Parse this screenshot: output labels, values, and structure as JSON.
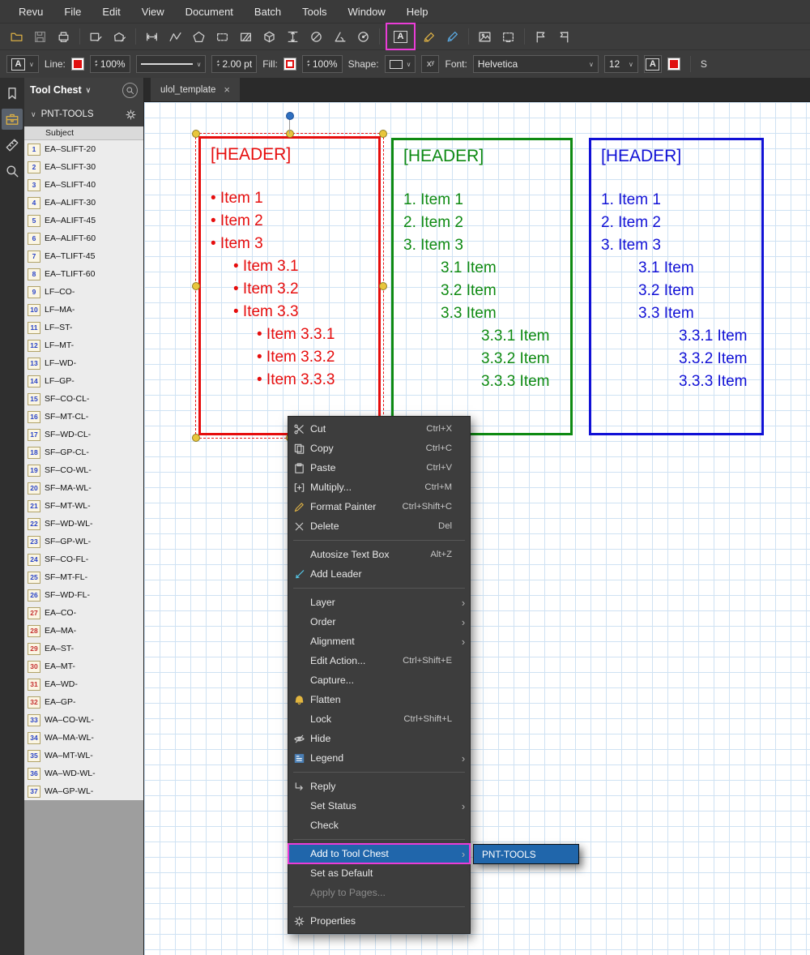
{
  "menubar": {
    "items": [
      "Revu",
      "File",
      "Edit",
      "View",
      "Document",
      "Batch",
      "Tools",
      "Window",
      "Help"
    ]
  },
  "toolbar_main": {
    "highlight_color": "#ea3cd7",
    "highlighted_icon": "text-box-icon",
    "groups": [
      {
        "icons": [
          "open-folder-icon",
          "save-icon",
          "print-icon"
        ]
      },
      {
        "icons": [
          "sketch-rectangle-icon",
          "sketch-polygon-icon"
        ]
      },
      {
        "icons": [
          "measure-length-icon",
          "measure-polyline-icon",
          "measure-polygon-icon",
          "measure-rectangle-icon",
          "measure-area-icon",
          "measure-volume-icon",
          "measure-height-icon",
          "measure-diameter-icon",
          "measure-angle-icon",
          "measure-radius-icon"
        ]
      },
      {
        "icons": [
          "text-box-icon",
          "highlighter-icon",
          "pen-icon"
        ]
      },
      {
        "icons": [
          "image-icon",
          "snapshot-icon"
        ]
      },
      {
        "icons": [
          "place-flag-icon",
          "remove-flag-icon"
        ]
      }
    ]
  },
  "toolbar_props": {
    "text_style_glyph": "A",
    "line": {
      "label": "Line:",
      "color": "#e01010",
      "opacity": "100%",
      "width": "2.00 pt"
    },
    "fill": {
      "label": "Fill:",
      "opacity": "100%"
    },
    "shape_label": "Shape:",
    "superscript_glyph": "xʸ",
    "font": {
      "label": "Font:",
      "family": "Helvetica",
      "size": "12"
    },
    "autosize_glyph": "A",
    "trailing_label": "S"
  },
  "tabbar": {
    "tabs": [
      {
        "label": "ulol_template",
        "active": true
      }
    ]
  },
  "left_strip": {
    "icons": [
      {
        "name": "bookmarks-icon",
        "active": false
      },
      {
        "name": "tool-chest-icon",
        "active": true
      },
      {
        "name": "measurements-icon",
        "active": false
      },
      {
        "name": "search-icon",
        "active": false
      }
    ]
  },
  "tool_chest": {
    "title": "Tool Chest",
    "group_label": "PNT-TOOLS",
    "column_header": "Subject",
    "items": [
      {
        "n": 1,
        "label": "EA–SLIFT-20"
      },
      {
        "n": 2,
        "label": "EA–SLIFT-30"
      },
      {
        "n": 3,
        "label": "EA–SLIFT-40"
      },
      {
        "n": 4,
        "label": "EA–ALIFT-30"
      },
      {
        "n": 5,
        "label": "EA–ALIFT-45"
      },
      {
        "n": 6,
        "label": "EA–ALIFT-60"
      },
      {
        "n": 7,
        "label": "EA–TLIFT-45"
      },
      {
        "n": 8,
        "label": "EA–TLIFT-60"
      },
      {
        "n": 9,
        "label": "LF–CO-"
      },
      {
        "n": 10,
        "label": "LF–MA-"
      },
      {
        "n": 11,
        "label": "LF–ST-"
      },
      {
        "n": 12,
        "label": "LF–MT-"
      },
      {
        "n": 13,
        "label": "LF–WD-"
      },
      {
        "n": 14,
        "label": "LF–GP-"
      },
      {
        "n": 15,
        "label": "SF–CO-CL-"
      },
      {
        "n": 16,
        "label": "SF–MT-CL-"
      },
      {
        "n": 17,
        "label": "SF–WD-CL-"
      },
      {
        "n": 18,
        "label": "SF–GP-CL-"
      },
      {
        "n": 19,
        "label": "SF–CO-WL-"
      },
      {
        "n": 20,
        "label": "SF–MA-WL-"
      },
      {
        "n": 21,
        "label": "SF–MT-WL-"
      },
      {
        "n": 22,
        "label": "SF–WD-WL-"
      },
      {
        "n": 23,
        "label": "SF–GP-WL-"
      },
      {
        "n": 24,
        "label": "SF–CO-FL-"
      },
      {
        "n": 25,
        "label": "SF–MT-FL-"
      },
      {
        "n": 26,
        "label": "SF–WD-FL-"
      },
      {
        "n": 27,
        "label": "EA–CO-",
        "red": true
      },
      {
        "n": 28,
        "label": "EA–MA-",
        "red": true
      },
      {
        "n": 29,
        "label": "EA–ST-",
        "red": true
      },
      {
        "n": 30,
        "label": "EA–MT-",
        "red": true
      },
      {
        "n": 31,
        "label": "EA–WD-",
        "red": true
      },
      {
        "n": 32,
        "label": "EA–GP-",
        "red": true
      },
      {
        "n": 33,
        "label": "WA–CO-WL-"
      },
      {
        "n": 34,
        "label": "WA–MA-WL-"
      },
      {
        "n": 35,
        "label": "WA–MT-WL-"
      },
      {
        "n": 36,
        "label": "WA–WD-WL-"
      },
      {
        "n": 37,
        "label": "WA–GP-WL-"
      }
    ]
  },
  "canvas": {
    "selection": {
      "outline_color": "#e81414",
      "handle_color": "#e8c63c",
      "rotation_handle_color": "#2e6fc0"
    },
    "text_boxes": [
      {
        "name": "bullet-list-text-box",
        "color": "#e60d0d",
        "list_style": "bullet",
        "header": "[HEADER]",
        "lines": [
          {
            "text": "• Item 1",
            "lvl": 0
          },
          {
            "text": "• Item 2",
            "lvl": 0
          },
          {
            "text": "• Item 3",
            "lvl": 0
          },
          {
            "text": "• Item 3.1",
            "lvl": 1
          },
          {
            "text": "• Item 3.2",
            "lvl": 1
          },
          {
            "text": "• Item 3.3",
            "lvl": 1
          },
          {
            "text": "• Item 3.3.1",
            "lvl": 2
          },
          {
            "text": "• Item 3.3.2",
            "lvl": 2
          },
          {
            "text": "• Item 3.3.3",
            "lvl": 2
          }
        ]
      },
      {
        "name": "numbered-list-text-box-green",
        "color": "#0e8a12",
        "list_style": "numbered",
        "header": "[HEADER]",
        "lines": [
          {
            "text": "1. Item 1",
            "lvl": 0
          },
          {
            "text": "2. Item 2",
            "lvl": 0
          },
          {
            "text": "3. Item 3",
            "lvl": 0
          },
          {
            "text": "3.1 Item",
            "lvl": 1
          },
          {
            "text": "3.2 Item",
            "lvl": 1
          },
          {
            "text": "3.3 Item",
            "lvl": 1
          },
          {
            "text": "3.3.1 Item",
            "lvl": 2
          },
          {
            "text": "3.3.2 Item",
            "lvl": 2
          },
          {
            "text": "3.3.3 Item",
            "lvl": 2
          }
        ]
      },
      {
        "name": "numbered-list-text-box-blue",
        "color": "#1111d6",
        "list_style": "numbered",
        "header": "[HEADER]",
        "lines": [
          {
            "text": "1. Item 1",
            "lvl": 0
          },
          {
            "text": "2. Item 2",
            "lvl": 0
          },
          {
            "text": "3. Item 3",
            "lvl": 0
          },
          {
            "text": "3.1 Item",
            "lvl": 1
          },
          {
            "text": "3.2 Item",
            "lvl": 1
          },
          {
            "text": "3.3 Item",
            "lvl": 1
          },
          {
            "text": "3.3.1 Item",
            "lvl": 2
          },
          {
            "text": "3.3.2 Item",
            "lvl": 2
          },
          {
            "text": "3.3.3 Item",
            "lvl": 2
          }
        ]
      }
    ]
  },
  "context_menu": {
    "highlight_bg": "#2066ab",
    "highlight_border": "#ea3cd7",
    "items": [
      {
        "label": "Cut",
        "shortcut": "Ctrl+X",
        "icon": "cut-icon"
      },
      {
        "label": "Copy",
        "shortcut": "Ctrl+C",
        "icon": "copy-icon"
      },
      {
        "label": "Paste",
        "shortcut": "Ctrl+V",
        "icon": "paste-icon"
      },
      {
        "label": "Multiply...",
        "shortcut": "Ctrl+M",
        "icon": "multiply-icon"
      },
      {
        "label": "Format Painter",
        "shortcut": "Ctrl+Shift+C",
        "icon": "format-painter-icon"
      },
      {
        "label": "Delete",
        "shortcut": "Del",
        "icon": "delete-icon"
      },
      {
        "sep": true
      },
      {
        "label": "Autosize Text Box",
        "shortcut": "Alt+Z"
      },
      {
        "label": "Add Leader",
        "icon": "add-leader-icon"
      },
      {
        "sep": true
      },
      {
        "label": "Layer",
        "submenu": true
      },
      {
        "label": "Order",
        "submenu": true
      },
      {
        "label": "Alignment",
        "submenu": true
      },
      {
        "label": "Edit Action...",
        "shortcut": "Ctrl+Shift+E"
      },
      {
        "label": "Capture..."
      },
      {
        "label": "Flatten",
        "icon": "flatten-icon"
      },
      {
        "label": "Lock",
        "shortcut": "Ctrl+Shift+L"
      },
      {
        "label": "Hide",
        "icon": "hide-icon"
      },
      {
        "label": "Legend",
        "icon": "legend-icon",
        "submenu": true
      },
      {
        "sep": true
      },
      {
        "label": "Reply",
        "icon": "reply-icon"
      },
      {
        "label": "Set Status",
        "submenu": true
      },
      {
        "label": "Check"
      },
      {
        "sep": true
      },
      {
        "label": "Add to Tool Chest",
        "submenu": true,
        "highlighted": true
      },
      {
        "label": "Set as Default"
      },
      {
        "label": "Apply to Pages...",
        "disabled": true
      },
      {
        "sep": true
      },
      {
        "label": "Properties",
        "icon": "properties-icon"
      }
    ]
  },
  "submenu": {
    "items": [
      {
        "label": "PNT-TOOLS",
        "highlighted": true
      }
    ]
  }
}
